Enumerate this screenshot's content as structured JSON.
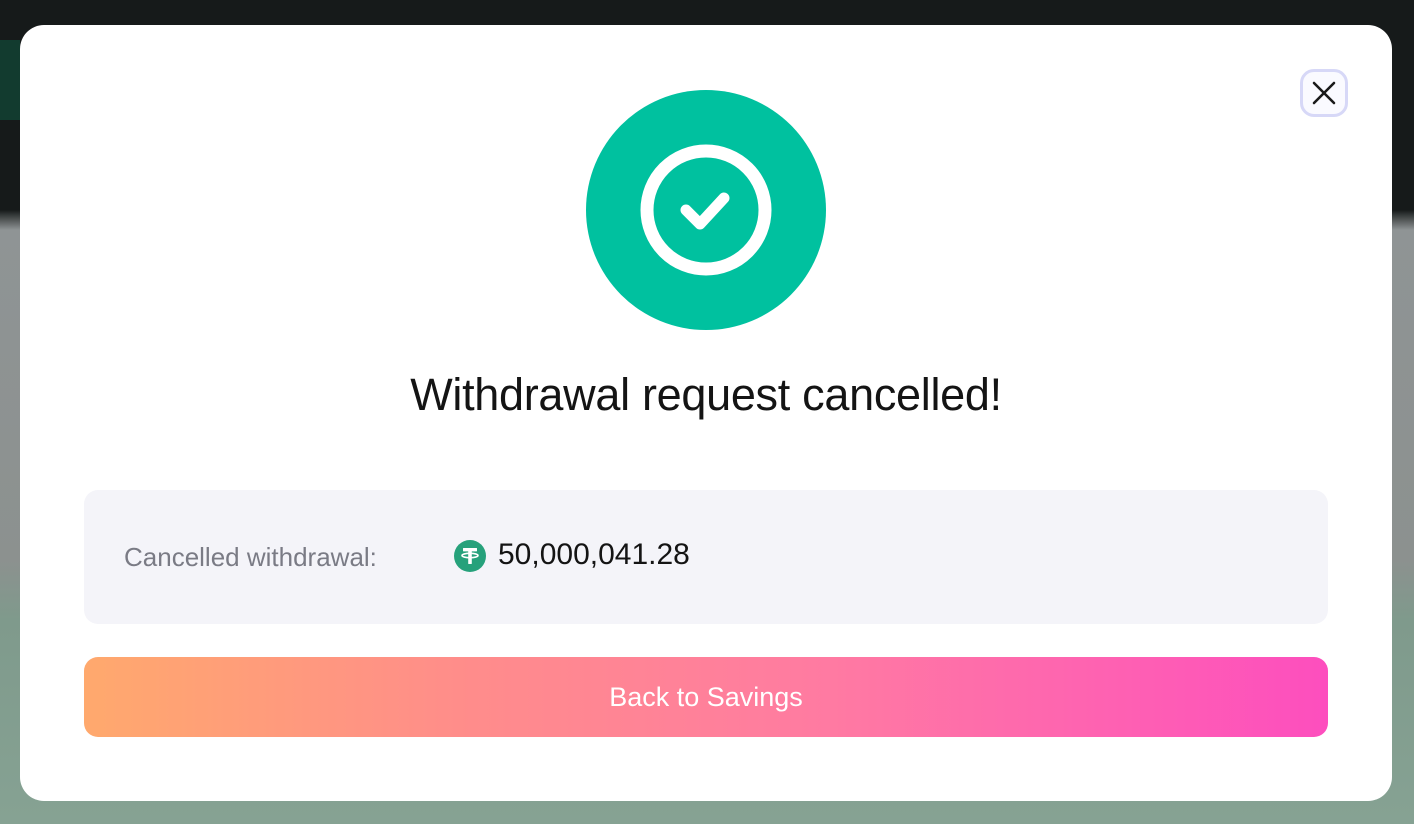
{
  "modal": {
    "title": "Withdrawal request cancelled!",
    "close_icon": "close-icon",
    "status_icon": "check-circle-icon",
    "details": {
      "label": "Cancelled withdrawal:",
      "token_icon": "tether-usdt-icon",
      "amount": "50,000,041.28"
    },
    "primary_button_label": "Back to Savings"
  },
  "colors": {
    "success": "#00c19f",
    "token": "#26a17b",
    "button_gradient_start": "#ffa96d",
    "button_gradient_end": "#fd4ebe",
    "panel_bg": "#f4f4f9"
  }
}
